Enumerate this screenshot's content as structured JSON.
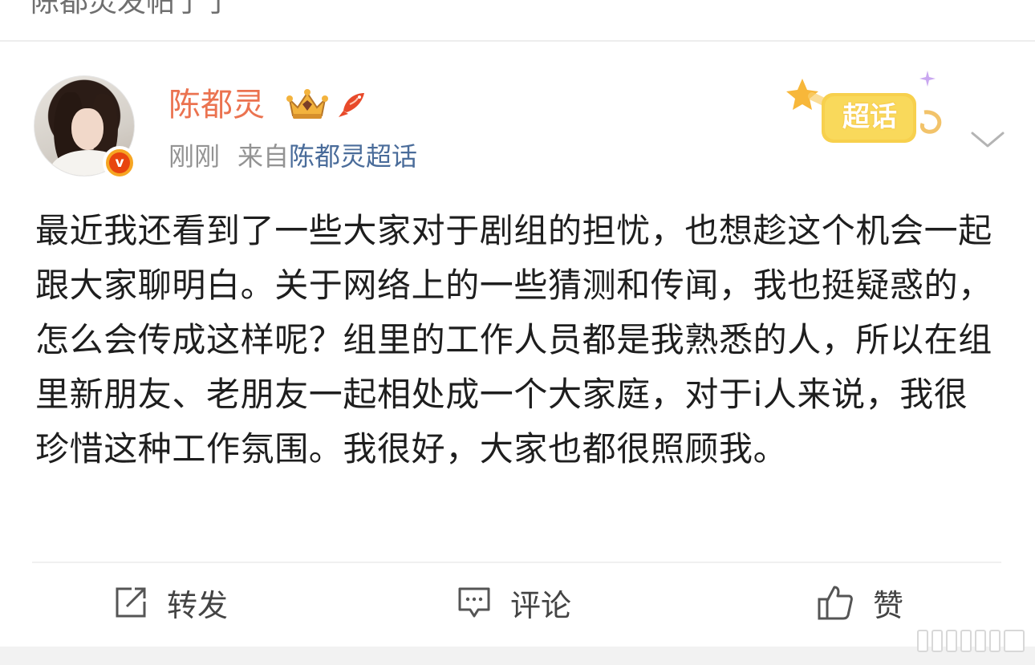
{
  "previous_post": {
    "title_fragment": "陈都灵发帖了了"
  },
  "post": {
    "author": {
      "name": "陈都灵",
      "verified_badge_letter": "v"
    },
    "meta": {
      "time": "刚刚",
      "source_prefix": "来自",
      "source_link": "陈都灵超话"
    },
    "supertopic_badge": "超话",
    "content": "最近我还看到了一些大家对于剧组的担忧，也想趁这个机会一起跟大家聊明白。关于网络上的一些猜测和传闻，我也挺疑惑的，怎么会传成这样呢？组里的工作人员都是我熟悉的人，所以在组里新朋友、老朋友一起相处成一个大家庭，对于i人来说，我很珍惜这种工作氛围。我很好，大家也都很照顾我。",
    "actions": {
      "repost": "转发",
      "comment": "评论",
      "like": "赞"
    }
  },
  "colors": {
    "username": "#eb7350",
    "link": "#4a6c9a",
    "meta_text": "#939393",
    "badge_orange": "#f6a623",
    "badge_red": "#e8450f",
    "supertopic_yellow": "#f7d04d"
  },
  "icons": {
    "crown": "crown-icon",
    "fish": "koi-fish-icon",
    "chevron": "chevron-down-icon",
    "repost": "repost-icon",
    "comment": "comment-icon",
    "like": "thumbs-up-icon"
  }
}
